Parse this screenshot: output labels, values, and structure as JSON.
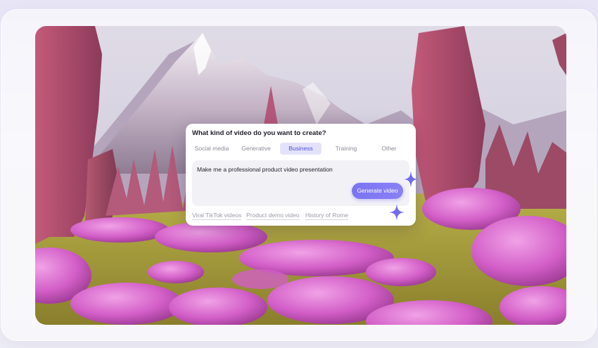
{
  "card": {
    "title": "What kind of video do you want to create?",
    "tabs": [
      {
        "label": "Social media",
        "active": false
      },
      {
        "label": "Generative",
        "active": false
      },
      {
        "label": "Business",
        "active": true
      },
      {
        "label": "Training",
        "active": false
      },
      {
        "label": "Other",
        "active": false
      }
    ],
    "prompt": "Make me a professional product video presentation",
    "generate_label": "Generate video",
    "suggestions": [
      "Viral TikTok videos",
      "Product demo video",
      "History of Rome"
    ]
  },
  "colors": {
    "accent": "#7a74f2",
    "active_tab_bg": "#e4e2fb",
    "active_tab_text": "#5250d8",
    "sparkle": "#6f6cf0"
  },
  "icons": [
    "sparkle-icon-large",
    "sparkle-icon-small"
  ]
}
